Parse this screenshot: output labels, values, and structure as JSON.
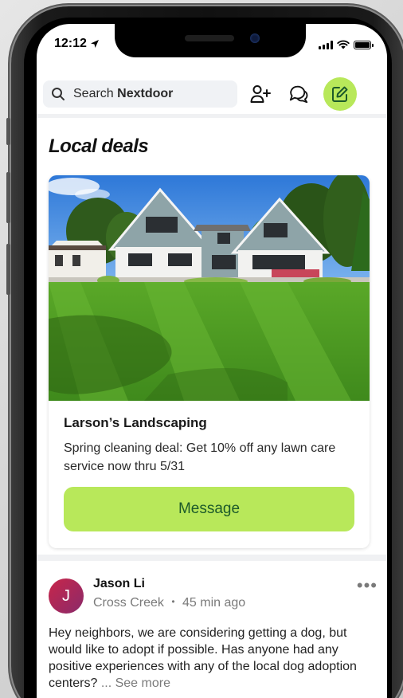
{
  "status_bar": {
    "time": "12:12"
  },
  "header": {
    "search_label": "Search",
    "search_brand": "Nextdoor"
  },
  "section": {
    "title": "Local deals"
  },
  "deal": {
    "business": "Larson’s Landscaping",
    "text": "Spring cleaning deal: Get 10% off any lawn care service now thru 5/31",
    "button_label": "Message"
  },
  "post": {
    "avatar_initial": "J",
    "author": "Jason Li",
    "neighborhood": "Cross Creek",
    "separator": "•",
    "time": "45 min ago",
    "more": "•••",
    "text": "Hey neighbors, we are considering getting a dog, but would like to adopt if possible. Has anyone had any positive experiences with any of the local dog adoption centers?",
    "see_more": "... See more"
  },
  "colors": {
    "accent": "#b8e85a",
    "accent_text": "#1c5a2a",
    "avatar": "#b8284e"
  },
  "icons": {
    "location": "navigation-arrow-icon",
    "search": "search-icon",
    "add_neighbor": "add-person-icon",
    "chat": "chat-bubbles-icon",
    "compose": "compose-icon"
  }
}
